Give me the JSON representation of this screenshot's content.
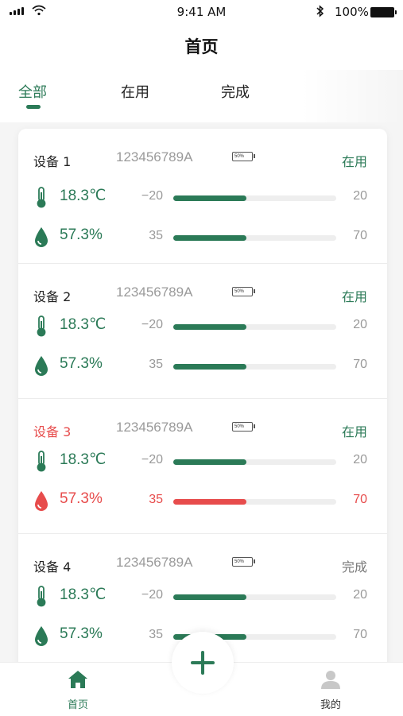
{
  "status_bar": {
    "time": "9:41 AM",
    "battery": "100%"
  },
  "nav": {
    "title": "首页"
  },
  "tabs": [
    {
      "label": "全部",
      "active": true
    },
    {
      "label": "在用",
      "active": false
    },
    {
      "label": "完成",
      "active": false
    }
  ],
  "devices": [
    {
      "name": "设备 1",
      "serial": "123456789A",
      "battery_label": "50%",
      "status": "在用",
      "alert": false,
      "temperature": {
        "value": "18.3℃",
        "min": "−20",
        "max": "20",
        "level": 0.45,
        "alert": false
      },
      "humidity": {
        "value": "57.3%",
        "min": "35",
        "max": "70",
        "level": 0.45,
        "alert": false
      }
    },
    {
      "name": "设备 2",
      "serial": "123456789A",
      "battery_label": "50%",
      "status": "在用",
      "alert": false,
      "temperature": {
        "value": "18.3℃",
        "min": "−20",
        "max": "20",
        "level": 0.45,
        "alert": false
      },
      "humidity": {
        "value": "57.3%",
        "min": "35",
        "max": "70",
        "level": 0.45,
        "alert": false
      }
    },
    {
      "name": "设备 3",
      "serial": "123456789A",
      "battery_label": "50%",
      "status": "在用",
      "alert": true,
      "temperature": {
        "value": "18.3℃",
        "min": "−20",
        "max": "20",
        "level": 0.45,
        "alert": false
      },
      "humidity": {
        "value": "57.3%",
        "min": "35",
        "max": "70",
        "level": 0.45,
        "alert": true
      }
    },
    {
      "name": "设备 4",
      "serial": "123456789A",
      "battery_label": "50%",
      "status": "完成",
      "alert": false,
      "temperature": {
        "value": "18.3℃",
        "min": "−20",
        "max": "20",
        "level": 0.45,
        "alert": false
      },
      "humidity": {
        "value": "57.3%",
        "min": "35",
        "max": "70",
        "level": 0.45,
        "alert": false
      }
    }
  ],
  "tabbar": {
    "home_label": "首页",
    "me_label": "我的"
  },
  "colors": {
    "accent": "#2b7a57",
    "alert": "#e74c4c"
  }
}
